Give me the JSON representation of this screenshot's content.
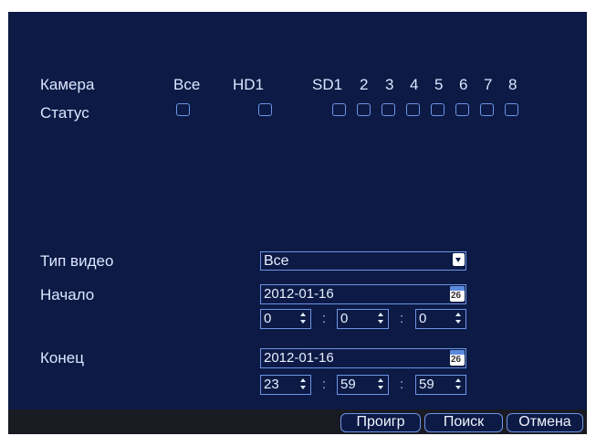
{
  "camera": {
    "label": "Камера",
    "all": "Все",
    "hd": "HD1",
    "sd": "SD1",
    "channels": [
      "2",
      "3",
      "4",
      "5",
      "6",
      "7",
      "8"
    ]
  },
  "status": {
    "label": "Статус"
  },
  "video_type": {
    "label": "Тип видео",
    "value": "Все"
  },
  "start": {
    "label": "Начало",
    "date": "2012-01-16",
    "hour": "0",
    "minute": "0",
    "second": "0"
  },
  "end": {
    "label": "Конец",
    "date": "2012-01-16",
    "hour": "23",
    "minute": "59",
    "second": "59"
  },
  "calendar_day": "26",
  "separator": ":",
  "buttons": {
    "play": "Проигр",
    "search": "Поиск",
    "cancel": "Отмена"
  },
  "colors": {
    "background": "#0c1a45",
    "border": "#6d95e6",
    "text": "#dde6ff"
  }
}
